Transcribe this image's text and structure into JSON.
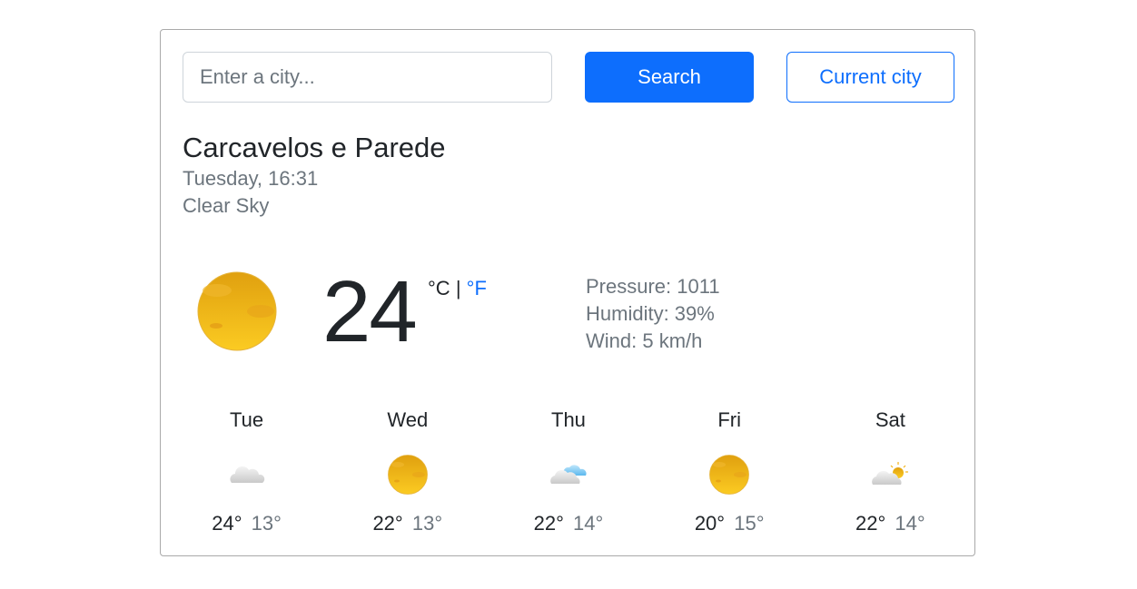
{
  "search": {
    "placeholder": "Enter a city...",
    "value": "",
    "search_label": "Search",
    "current_city_label": "Current city"
  },
  "current": {
    "city": "Carcavelos e Parede",
    "datetime": "Tuesday, 16:31",
    "description": "Clear Sky",
    "icon": "sun-icon",
    "temperature": "24",
    "unit_c": "°C",
    "unit_separator": "|",
    "unit_f": "°F",
    "pressure": "Pressure: 1011",
    "humidity": "Humidity: 39%",
    "wind": "Wind: 5 km/h"
  },
  "forecast": [
    {
      "day": "Tue",
      "icon": "cloud-icon",
      "max": "24°",
      "min": "13°"
    },
    {
      "day": "Wed",
      "icon": "sun-icon",
      "max": "22°",
      "min": "13°"
    },
    {
      "day": "Thu",
      "icon": "cloud-icon",
      "max": "22°",
      "min": "14°"
    },
    {
      "day": "Fri",
      "icon": "sun-icon",
      "max": "20°",
      "min": "15°"
    },
    {
      "day": "Sat",
      "icon": "partly-cloudy-icon",
      "max": "22°",
      "min": "14°"
    }
  ],
  "colors": {
    "accent": "#0d6efd",
    "muted_text": "#6c757d",
    "text": "#212529",
    "card_border": "#a9a9a9",
    "sun": "#f2b31a"
  }
}
